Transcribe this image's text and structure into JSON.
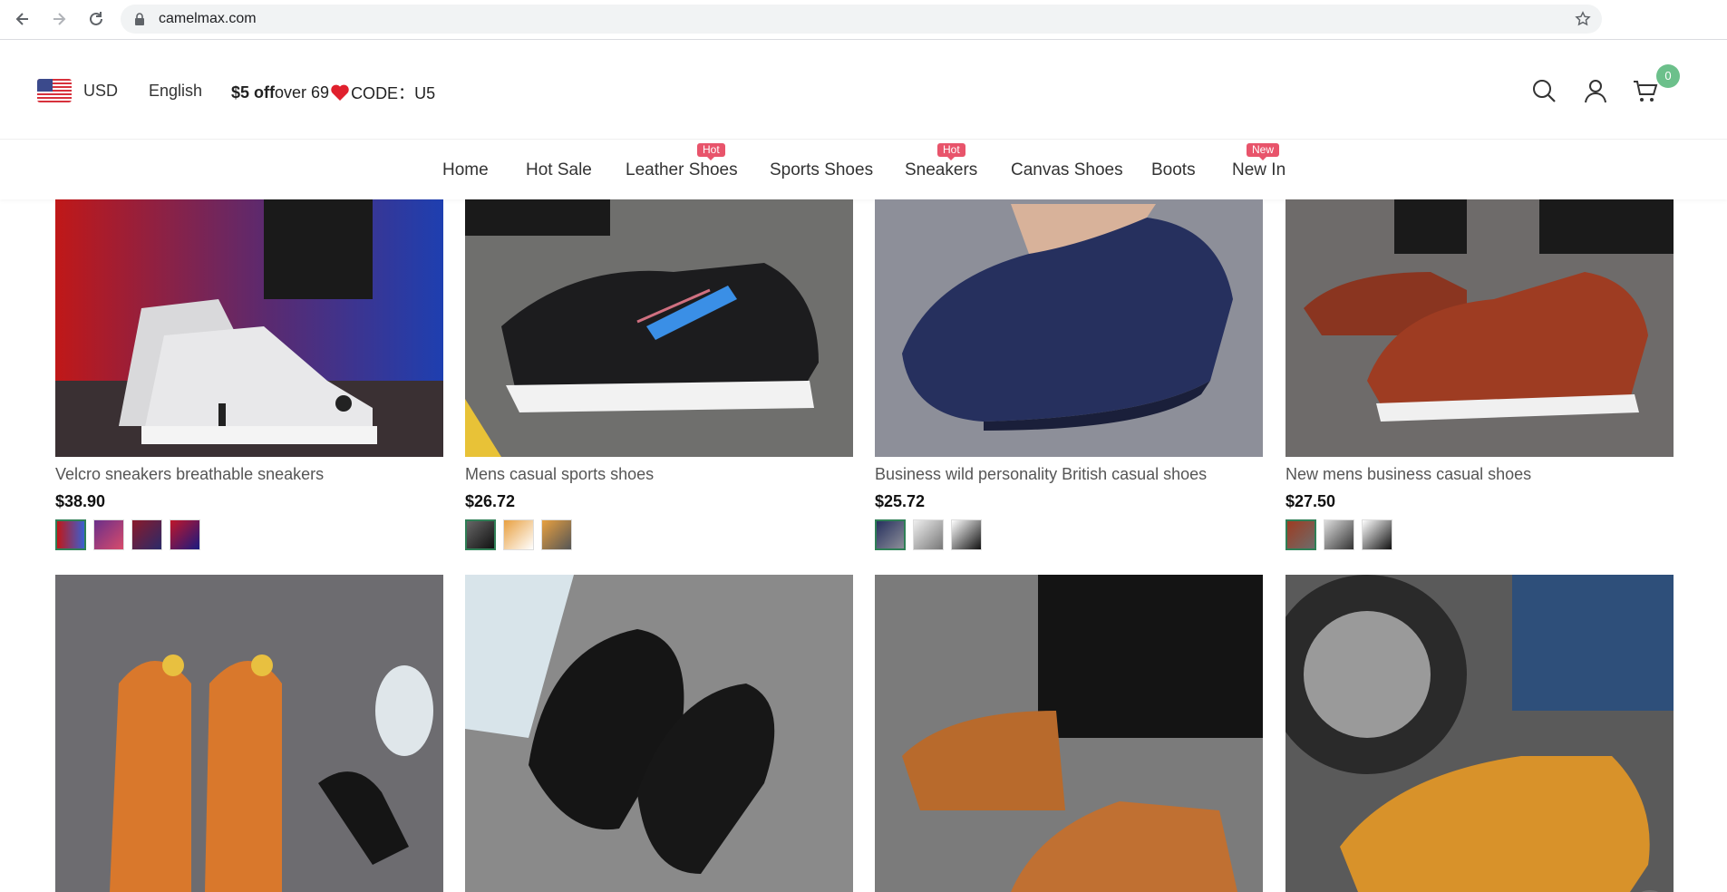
{
  "browser": {
    "url": "camelmax.com",
    "icons": [
      "back-arrow-icon",
      "forward-arrow-icon",
      "reload-icon",
      "lock-icon",
      "bookmark-star-icon"
    ]
  },
  "header": {
    "currency": "USD",
    "language": "English",
    "promo_bold": "$5 off",
    "promo_text": " over 69",
    "promo_code": "CODE：U5",
    "cart_count": "0",
    "icons": [
      "us-flag-icon",
      "heart-icon",
      "search-icon",
      "user-icon",
      "cart-icon"
    ]
  },
  "nav": {
    "items": [
      {
        "label": "Home",
        "tag": ""
      },
      {
        "label": "Hot Sale",
        "tag": ""
      },
      {
        "label": "Leather Shoes",
        "tag": "Hot"
      },
      {
        "label": "Sports Shoes",
        "tag": ""
      },
      {
        "label": "Sneakers",
        "tag": "Hot"
      },
      {
        "label": "Canvas Shoes",
        "tag": ""
      },
      {
        "label": "Boots",
        "tag": ""
      },
      {
        "label": "New In",
        "tag": "New"
      }
    ]
  },
  "products": [
    {
      "title": "Velcro sneakers breathable sneakers",
      "price": "$38.90",
      "swatch_count": 4
    },
    {
      "title": "Mens casual sports shoes",
      "price": "$26.72",
      "swatch_count": 3
    },
    {
      "title": "Business wild personality British casual shoes",
      "price": "$25.72",
      "swatch_count": 3
    },
    {
      "title": "New mens business casual shoes",
      "price": "$27.50",
      "swatch_count": 3
    },
    {
      "title": "",
      "price": "",
      "swatch_count": 0
    },
    {
      "title": "",
      "price": "",
      "swatch_count": 0
    },
    {
      "title": "",
      "price": "",
      "swatch_count": 0
    },
    {
      "title": "",
      "price": "",
      "swatch_count": 0
    }
  ],
  "colors": {
    "tag_red": "#e8546b",
    "badge_green": "#6cc08b",
    "swatch_active": "#2f7f56"
  },
  "back_to_top_icon": "arrow-up-to-line-icon"
}
